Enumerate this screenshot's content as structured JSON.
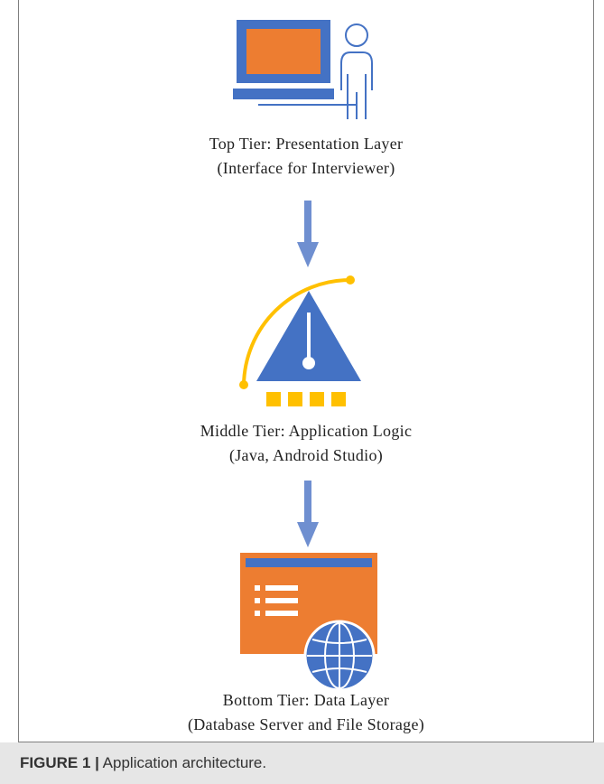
{
  "tiers": [
    {
      "title": "Top Tier: Presentation Layer",
      "subtitle": "(Interface for Interviewer)",
      "icon": "laptop-user-icon"
    },
    {
      "title": "Middle Tier: Application Logic",
      "subtitle": "(Java, Android Studio)",
      "icon": "application-logic-icon"
    },
    {
      "title": "Bottom Tier: Data Layer",
      "subtitle": "(Database Server and File Storage)",
      "icon": "web-database-icon"
    }
  ],
  "caption": {
    "label": "FIGURE 1 |",
    "text": " Application architecture."
  },
  "colors": {
    "blue": "#4472c4",
    "orange": "#ed7d31",
    "gold": "#ffc000",
    "arrow": "#6f8fd0",
    "frame": "#7f7f7f"
  }
}
